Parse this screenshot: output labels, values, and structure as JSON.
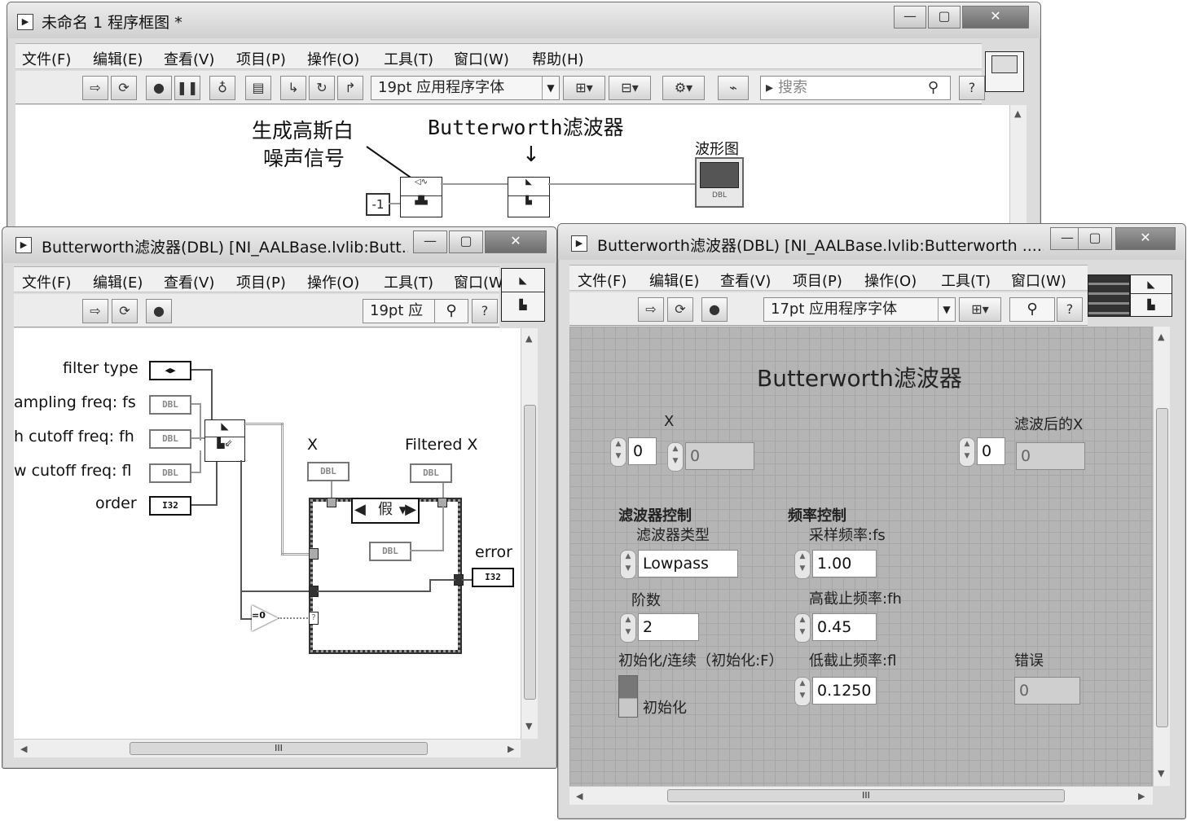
{
  "main_window": {
    "title": "未命名 1 程序框图 *",
    "menu": [
      "文件(F)",
      "编辑(E)",
      "查看(V)",
      "项目(P)",
      "操作(O)",
      "工具(T)",
      "窗口(W)",
      "帮助(H)"
    ],
    "font_select": "19pt 应用程序字体",
    "search_placeholder": "搜索",
    "labels": {
      "gauss_line1": "生成高斯白",
      "gauss_line2": "噪声信号",
      "butterworth": "Butterworth滤波器",
      "waveform": "波形图",
      "const_value": "-1",
      "dbl": "DBL"
    }
  },
  "block_window": {
    "title": "Butterworth滤波器(DBL) [NI_AALBase.lvlib:Butt...",
    "menu": [
      "文件(F)",
      "编辑(E)",
      "查看(V)",
      "项目(P)",
      "操作(O)",
      "工具(T)",
      "窗口(W"
    ],
    "font_select": "19pt 应",
    "inputs": [
      {
        "label": "filter type",
        "type": "◀▶"
      },
      {
        "label": "ampling freq: fs",
        "type": "DBL"
      },
      {
        "label": "h cutoff freq: fh",
        "type": "DBL"
      },
      {
        "label": "w cutoff freq: fl",
        "type": "DBL"
      },
      {
        "label": "order",
        "type": "I32"
      }
    ],
    "x_label": "X",
    "filtered_label": "Filtered X",
    "error_label": "error",
    "case_selector": "假",
    "dbl": "DBL",
    "i32": "I32",
    "compare": "=0",
    "question": "?",
    "scroll_mark": "III"
  },
  "front_window": {
    "title": "Butterworth滤波器(DBL) [NI_AALBase.lvlib:Butterworth ......",
    "menu": [
      "文件(F)",
      "编辑(E)",
      "查看(V)",
      "项目(P)",
      "操作(O)",
      "工具(T)",
      "窗口(W)"
    ],
    "font_select": "17pt 应用程序字体",
    "panel_title": "Butterworth滤波器",
    "x_label": "X",
    "x_index": "0",
    "x_value": "0",
    "filtered_label": "滤波后的X",
    "filtered_index": "0",
    "filtered_value": "0",
    "filter_control": "滤波器控制",
    "filter_type_label": "滤波器类型",
    "filter_type_value": "Lowpass",
    "order_label": "阶数",
    "order_value": "2",
    "init_label": "初始化/连续（初始化:F）",
    "init_button": "初始化",
    "freq_control": "频率控制",
    "fs_label": "采样频率:fs",
    "fs_value": "1.00",
    "fh_label": "高截止频率:fh",
    "fh_value": "0.45",
    "fl_label": "低截止频率:fl",
    "fl_value": "0.1250",
    "error_label": "错误",
    "error_value": "0",
    "scroll_mark": "III"
  }
}
